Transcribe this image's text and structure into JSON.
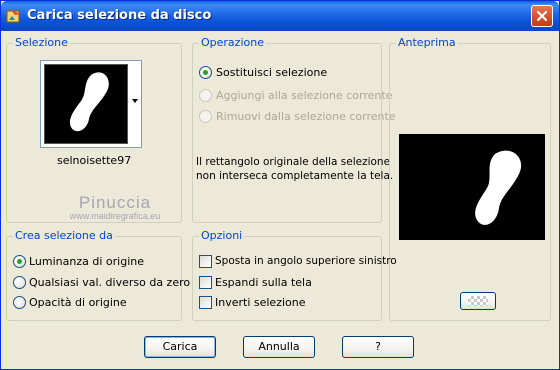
{
  "window": {
    "title": "Carica selezione da disco"
  },
  "selezione": {
    "label": "Selezione",
    "file_name": "selnoisette97"
  },
  "operazione": {
    "label": "Operazione",
    "options": [
      {
        "label": "Sostituisci selezione",
        "checked": true,
        "enabled": true
      },
      {
        "label": "Aggiungi alla selezione corrente",
        "checked": false,
        "enabled": false
      },
      {
        "label": "Rimuovi dalla selezione corrente",
        "checked": false,
        "enabled": false
      }
    ],
    "message_line1": "Il rettangolo originale della selezione",
    "message_line2": "non interseca completamente la tela."
  },
  "anteprima": {
    "label": "Anteprima"
  },
  "crea": {
    "label": "Crea selezione da",
    "options": [
      {
        "label": "Luminanza di origine",
        "checked": true
      },
      {
        "label": "Qualsiasi val. diverso da zero",
        "checked": false
      },
      {
        "label": "Opacità di origine",
        "checked": false
      }
    ]
  },
  "opzioni": {
    "label": "Opzioni",
    "options": [
      {
        "label": "Sposta in angolo superiore sinistro",
        "checked": false
      },
      {
        "label": "Espandi sulla tela",
        "checked": false
      },
      {
        "label": "Inverti selezione",
        "checked": false
      }
    ]
  },
  "buttons": {
    "load": "Carica",
    "cancel": "Annulla",
    "help": "?"
  },
  "watermark": {
    "name": "Pinuccia",
    "url": "www.maidiregrafica.eu"
  },
  "colors": {
    "group_label": "#0046d5",
    "titlebar": "#0a5fe6",
    "dialog_bg": "#ece9d8"
  }
}
